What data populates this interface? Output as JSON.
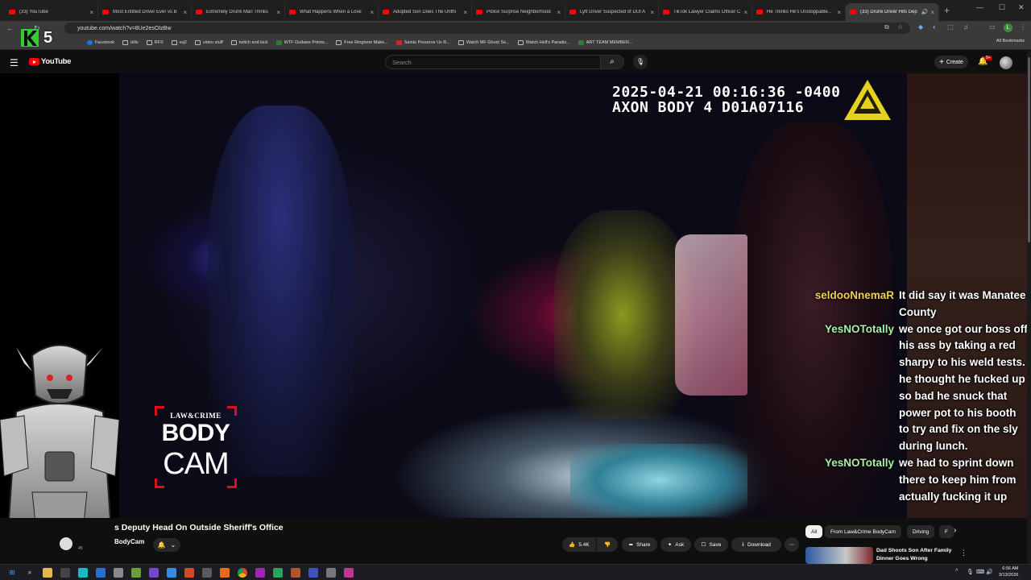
{
  "browser": {
    "tabs": [
      {
        "title": "(33) YouTube",
        "active": false
      },
      {
        "title": "Most Entitled Driver Ever vs B",
        "active": false
      },
      {
        "title": "Extremely Drunk Man Thinks",
        "active": false
      },
      {
        "title": "What Happens When a Love",
        "active": false
      },
      {
        "title": "Adopted Son Does The Unthi",
        "active": false
      },
      {
        "title": "Police Surprise Neighborhood",
        "active": false
      },
      {
        "title": "Lyft Driver Suspected of DUI A",
        "active": false
      },
      {
        "title": "TikTok Lawyer Claims Officer C",
        "active": false
      },
      {
        "title": "He Thinks He's Unstoppable...",
        "active": false
      },
      {
        "title": "(33) Drunk Driver Hits Dep",
        "active": true
      }
    ],
    "url": "youtube.com/watch?v=8Ue2esOIzBw",
    "bookmarks": [
      {
        "label": "Facebook",
        "icon": "facebook-icon"
      },
      {
        "label": "bills",
        "icon": "folder-icon"
      },
      {
        "label": "RFS",
        "icon": "folder-icon"
      },
      {
        "label": "eq2",
        "icon": "folder-icon"
      },
      {
        "label": "video stuff",
        "icon": "folder-icon"
      },
      {
        "label": "twitch and kick",
        "icon": "folder-icon"
      },
      {
        "label": "WTF Outlaws Points...",
        "icon": "green-site-icon"
      },
      {
        "label": "Free Ringtone Make...",
        "icon": "site-icon"
      },
      {
        "label": "Saints Preserve Us R...",
        "icon": "saints-icon"
      },
      {
        "label": "Watch MF Ghost Se...",
        "icon": "site-icon"
      },
      {
        "label": "Watch Hell's Paradis...",
        "icon": "site-icon"
      },
      {
        "label": "ART TEAM MEMBER...",
        "icon": "green-site-icon"
      }
    ],
    "all_bookmarks_label": "All Bookmarks",
    "profile_initial": "L"
  },
  "youtube": {
    "logo_text": "YouTube",
    "search_placeholder": "Search",
    "create_label": "Create",
    "notification_count": "9+"
  },
  "video": {
    "timestamp_line1": "2025-04-21 00:16:36 -0400",
    "timestamp_line2": "AXON BODY 4 D01A07116",
    "watermark": {
      "small": "LAW&CRIME",
      "big1": "BODY",
      "big2": "CAM"
    }
  },
  "chat": [
    {
      "user": "seldooNnemaR",
      "color": "#f2cf54",
      "text": "It did say it was Manatee County"
    },
    {
      "user": "YesNOTotally",
      "color": "#a8f0a8",
      "text": "we once got our boss off his ass by taking a red sharpy to his weld tests. he thought he fucked up so bad he snuck that power pot to his booth to try and fix on the sly during lunch."
    },
    {
      "user": "YesNOTotally",
      "color": "#a8f0a8",
      "text": "we had to sprint down there to keep him from actually fucking it up"
    }
  ],
  "below": {
    "title": "s Deputy Head On Outside Sheriff's Office",
    "channel": "BodyCam",
    "subs": "45",
    "likes": "5.4K",
    "share_label": "Share",
    "ask_label": "Ask",
    "save_label": "Save",
    "download_label": "Download",
    "chips": [
      "All",
      "From Law&Crime BodyCam",
      "Driving",
      "F"
    ],
    "recommended_title": "Dad Shoots Son After Family Dinner Goes Wrong"
  },
  "taskbar": {
    "time": "6:56 AM",
    "date": "3/13/2026"
  },
  "stream_overlay": {
    "logo_text": "5"
  },
  "colors": {
    "youtube_red": "#ff0000",
    "chat_user_1": "#f2cf54",
    "chat_user_2": "#a8f0a8",
    "watermark_red": "#dd1111"
  }
}
